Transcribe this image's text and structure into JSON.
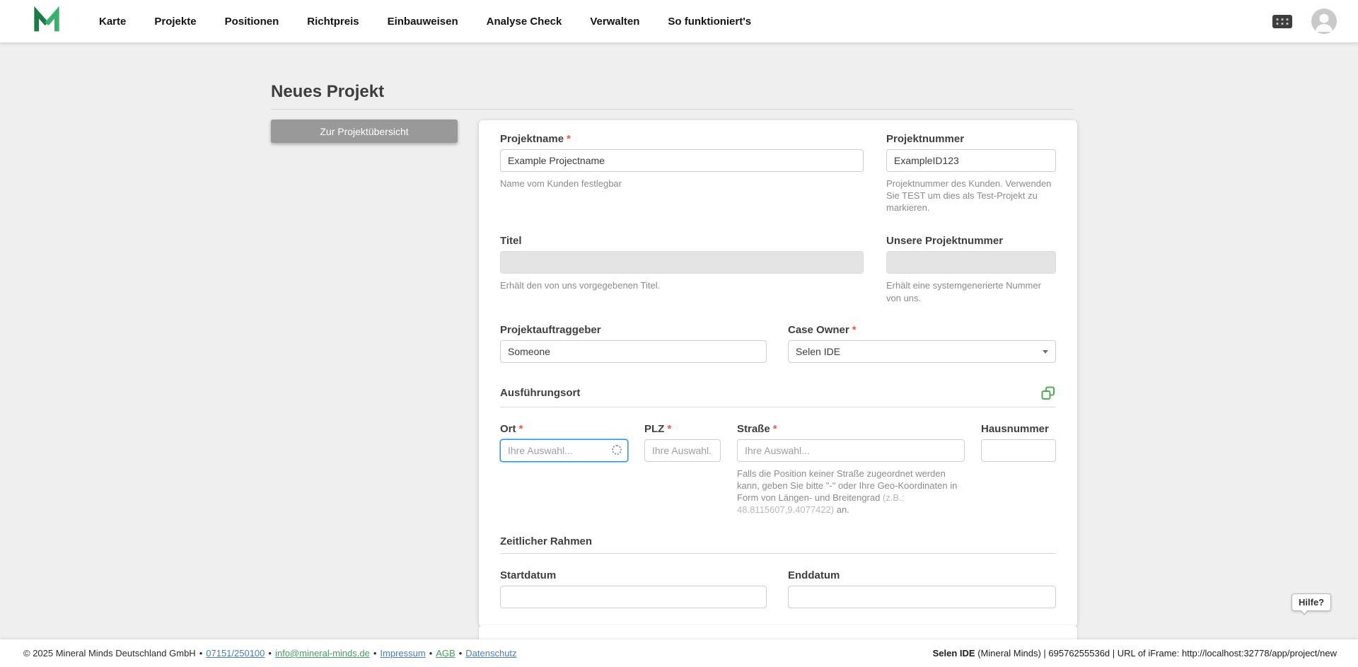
{
  "nav": {
    "items": [
      "Karte",
      "Projekte",
      "Positionen",
      "Richtpreis",
      "Einbauweisen",
      "Analyse Check",
      "Verwalten",
      "So funktioniert's"
    ]
  },
  "page": {
    "title": "Neues Projekt",
    "back_button": "Zur Projektübersicht"
  },
  "form": {
    "projektname": {
      "label": "Projektname",
      "required": "*",
      "value": "Example Projectname",
      "helper": "Name vom Kunden festlegbar"
    },
    "projektnummer": {
      "label": "Projektnummer",
      "value": "ExampleID123",
      "helper": "Projektnummer des Kunden. Verwenden Sie TEST um dies als Test-Projekt zu markieren."
    },
    "titel": {
      "label": "Titel",
      "helper": "Erhält den von uns vorgegebenen Titel."
    },
    "unsere_projektnummer": {
      "label": "Unsere Projektnummer",
      "helper": "Erhält eine systemgenerierte Nummer von uns."
    },
    "projektauftraggeber": {
      "label": "Projektauftraggeber",
      "value": "Someone"
    },
    "case_owner": {
      "label": "Case Owner",
      "required": "*",
      "value": "Selen IDE"
    },
    "section_ausfuehrungsort": "Ausführungsort",
    "section_zeitlicher_rahmen": "Zeitlicher Rahmen",
    "ort": {
      "label": "Ort",
      "required": "*",
      "placeholder": "Ihre Auswahl..."
    },
    "plz": {
      "label": "PLZ",
      "required": "*",
      "placeholder": "Ihre Auswahl."
    },
    "strasse": {
      "label": "Straße",
      "required": "*",
      "placeholder": "Ihre Auswahl...",
      "helper_main": "Falls die Position keiner Straße zugeordnet werden kann, geben Sie bitte \"-\" oder Ihre Geo-Koordinaten in Form von Längen- und Breitengrad ",
      "helper_example": "(z.B.: 48.8115607,9.4077422)",
      "helper_suffix": " an."
    },
    "hausnummer": {
      "label": "Hausnummer"
    },
    "startdatum": {
      "label": "Startdatum"
    },
    "enddatum": {
      "label": "Enddatum"
    }
  },
  "help": {
    "label": "Hilfe?"
  },
  "footer": {
    "copyright": "© 2025 Mineral Minds Deutschland GmbH",
    "separator": "•",
    "phone": "07151/250100",
    "email": "info@mineral-minds.de",
    "impressum": "Impressum",
    "agb": "AGB",
    "datenschutz": "Datenschutz",
    "right_bold": "Selen IDE",
    "right_rest": " (Mineral Minds) | 69576255536d | URL of iFrame: http://localhost:32778/app/project/new"
  },
  "colors": {
    "accent_green": "#35b36b",
    "focus_blue": "#2196f3",
    "required_red": "#f5593d",
    "button_gray": "#999999"
  }
}
